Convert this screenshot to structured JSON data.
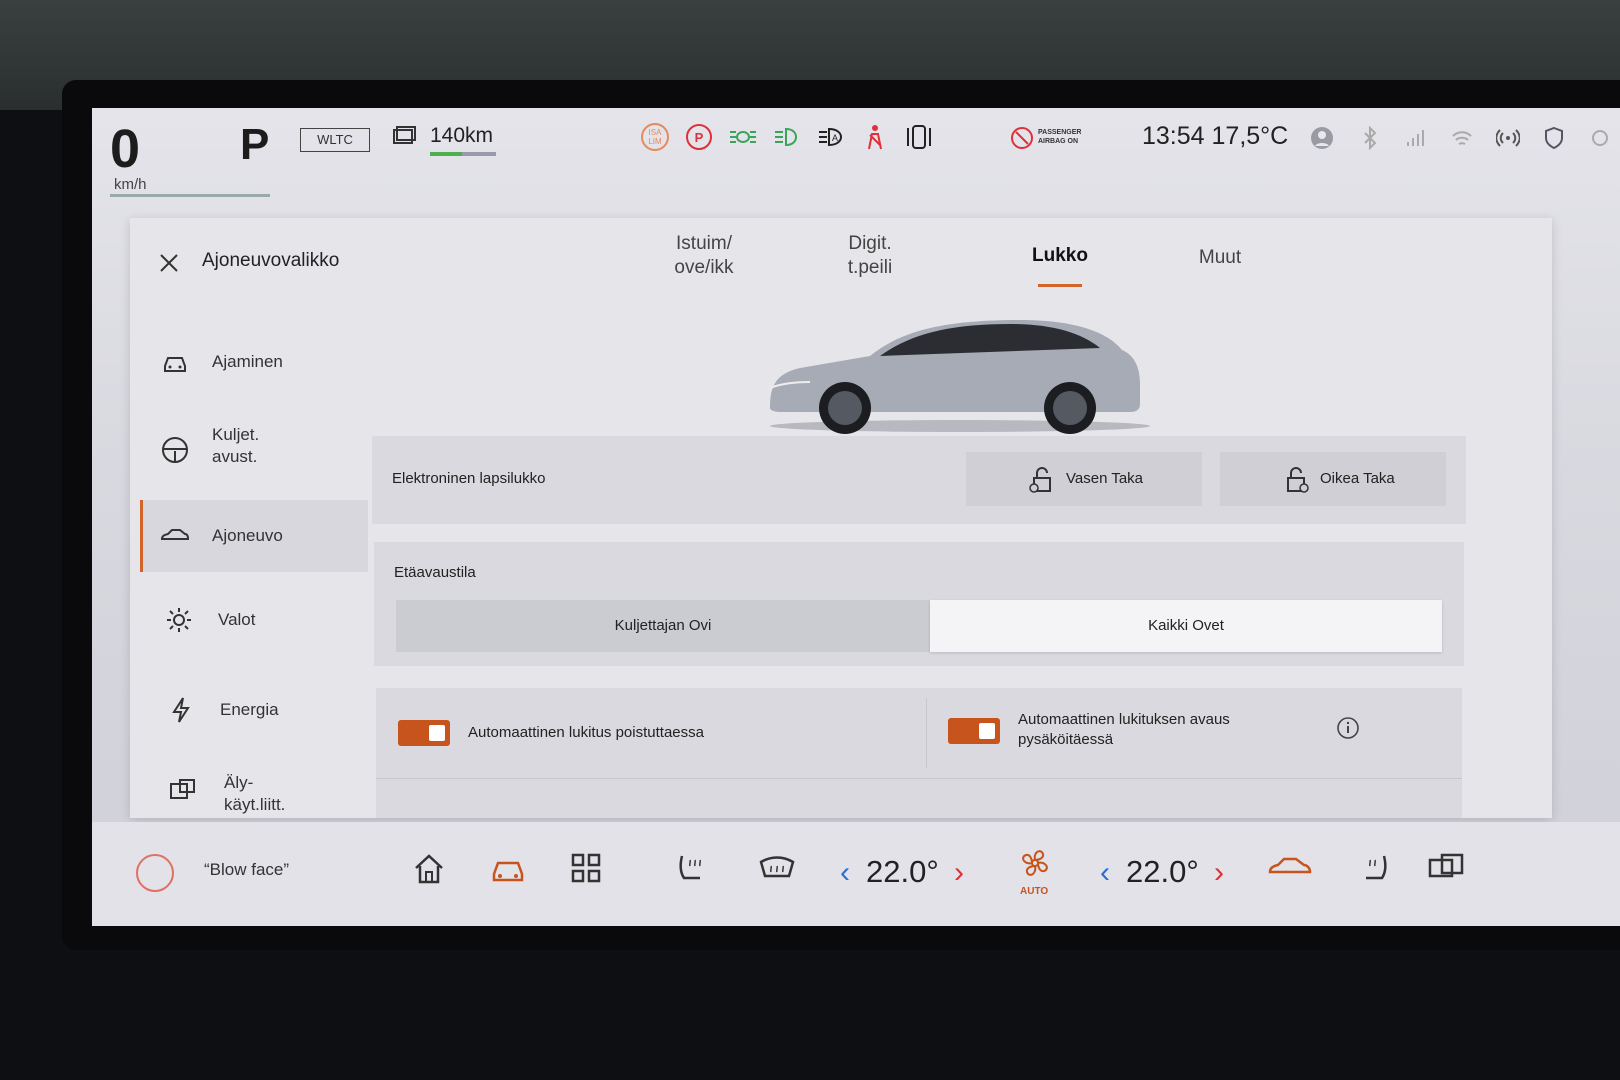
{
  "status": {
    "speed": "0",
    "speed_unit": "km/h",
    "gear": "P",
    "cycle": "WLTC",
    "range": "140km",
    "isa": "ISA LIM",
    "airbag": "PASSENGER AIRBAG ON",
    "time_temp": "13:54 17,5°C"
  },
  "panel": {
    "title": "Ajoneuvovalikko",
    "tabs": [
      {
        "l1": "Istuim/",
        "l2": "ove/ikk"
      },
      {
        "l1": "Digit.",
        "l2": "t.peili"
      },
      {
        "l1": "Lukko",
        "l2": ""
      },
      {
        "l1": "Muut",
        "l2": ""
      }
    ],
    "active_tab": "Lukko"
  },
  "sidebar": {
    "items": [
      {
        "l1": "Ajaminen",
        "l2": ""
      },
      {
        "l1": "Kuljet.",
        "l2": "avust."
      },
      {
        "l1": "Ajoneuvo",
        "l2": ""
      },
      {
        "l1": "Valot",
        "l2": ""
      },
      {
        "l1": "Energia",
        "l2": ""
      },
      {
        "l1": "Äly-",
        "l2": "käyt.liitt."
      }
    ],
    "active": "Ajoneuvo"
  },
  "child_lock": {
    "label": "Elektroninen lapsilukko",
    "left": "Vasen Taka",
    "right": "Oikea Taka"
  },
  "remote_unlock": {
    "label": "Etäavaustila",
    "options": [
      "Kuljettajan Ovi",
      "Kaikki Ovet"
    ],
    "selected": "Kaikki Ovet"
  },
  "toggles": {
    "auto_lock": {
      "l1": "Automaattinen lukitus poistuttaessa",
      "on": true
    },
    "auto_unlock": {
      "l1": "Automaattinen lukituksen avaus",
      "l2": "pysäköitäessä",
      "on": true
    }
  },
  "bottom": {
    "voice_label": "“Blow face”",
    "temp_left": "22.0°",
    "temp_right": "22.0°",
    "fan_mode": "AUTO"
  },
  "colors": {
    "accent": "#c8541d",
    "panel": "#e6e6ea"
  }
}
